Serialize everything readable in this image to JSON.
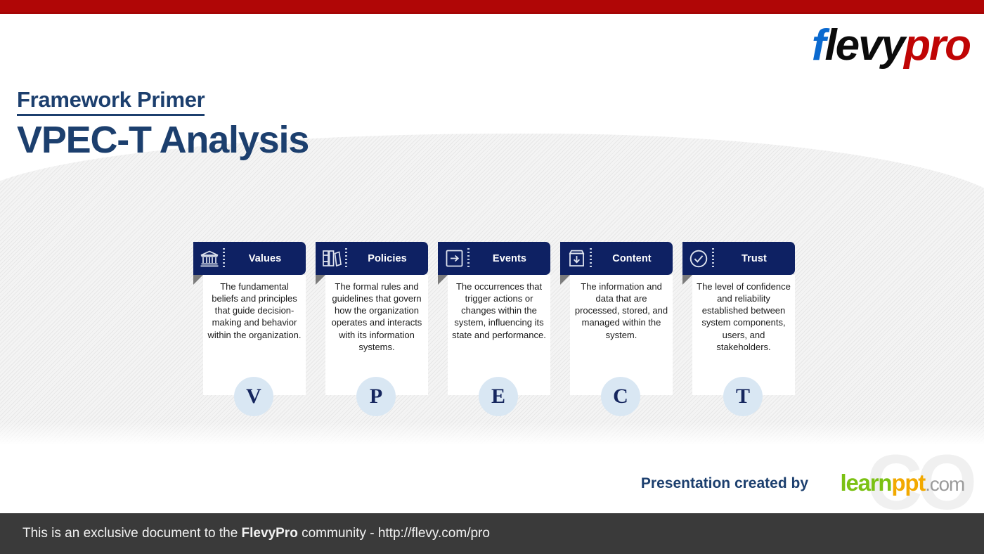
{
  "brand": {
    "logo_f": "f",
    "logo_levy": "levy",
    "logo_pro": "pro",
    "accent_red": "#b00606",
    "navy": "#1c3f6e",
    "card_navy": "#0e2163",
    "circle_fill": "#d9e7f3"
  },
  "header": {
    "kicker": "Framework Primer",
    "title": "VPEC-T Analysis"
  },
  "cards": [
    {
      "label": "Values",
      "icon": "bank-columns-icon",
      "description": "The fundamental beliefs and principles that guide decision-making and behavior within the organization.",
      "letter": "V"
    },
    {
      "label": "Policies",
      "icon": "books-icon",
      "description": "The formal rules and guidelines that govern how the organization operates and interacts with its information systems.",
      "letter": "P"
    },
    {
      "label": "Events",
      "icon": "arrow-right-box-icon",
      "description": "The occurrences that trigger actions or changes within the system, influencing its state and performance.",
      "letter": "E"
    },
    {
      "label": "Content",
      "icon": "archive-download-icon",
      "description": "The information and data that are processed, stored, and managed within the system.",
      "letter": "C"
    },
    {
      "label": "Trust",
      "icon": "check-circle-icon",
      "description": "The level of confidence and reliability established between system components, users, and stakeholders.",
      "letter": "T"
    }
  ],
  "credit": {
    "text": "Presentation created by",
    "logo_learn": "learn",
    "logo_ppt": "ppt",
    "logo_com": ".com",
    "watermark": "CO"
  },
  "footer": {
    "prefix": "This is an exclusive document to the ",
    "brand": "FlevyPro",
    "suffix": " community - http://flevy.com/pro"
  }
}
